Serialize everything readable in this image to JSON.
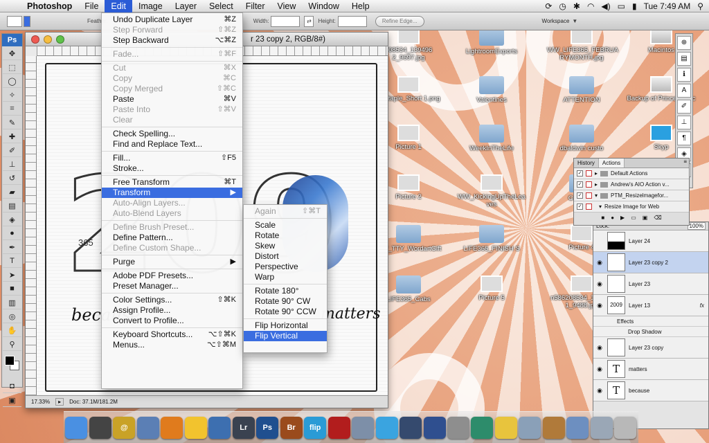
{
  "menubar": {
    "app_name": "Photoshop",
    "items": [
      "File",
      "Edit",
      "Image",
      "Layer",
      "Select",
      "Filter",
      "View",
      "Window",
      "Help"
    ],
    "clock": "Tue 7:49 AM"
  },
  "optionsbar": {
    "feather_label": "Feather:",
    "width_label": "Width:",
    "height_label": "Height:",
    "refine_edge": "Refine Edge...",
    "workspace": "Workspace"
  },
  "tools": {
    "badge": "Ps"
  },
  "document": {
    "title": "r 23 copy 2, RGB/8#)",
    "zoom": "17.33%",
    "doc_size": "Doc: 37.1M/181.2M",
    "canvas_number": "209",
    "canvas_text": "because",
    "canvas_text2": "matters",
    "photo_number": "365"
  },
  "edit_menu": {
    "items": [
      {
        "label": "Undo Duplicate Layer",
        "shortcut": "⌘Z",
        "disabled": false
      },
      {
        "label": "Step Forward",
        "shortcut": "⇧⌘Z",
        "disabled": true
      },
      {
        "label": "Step Backward",
        "shortcut": "⌥⌘Z",
        "disabled": false
      },
      {
        "sep": true
      },
      {
        "label": "Fade...",
        "shortcut": "⇧⌘F",
        "disabled": true
      },
      {
        "sep": true
      },
      {
        "label": "Cut",
        "shortcut": "⌘X",
        "disabled": true
      },
      {
        "label": "Copy",
        "shortcut": "⌘C",
        "disabled": true
      },
      {
        "label": "Copy Merged",
        "shortcut": "⇧⌘C",
        "disabled": true
      },
      {
        "label": "Paste",
        "shortcut": "⌘V",
        "disabled": false
      },
      {
        "label": "Paste Into",
        "shortcut": "⇧⌘V",
        "disabled": true
      },
      {
        "label": "Clear",
        "shortcut": "",
        "disabled": true
      },
      {
        "sep": true
      },
      {
        "label": "Check Spelling...",
        "shortcut": "",
        "disabled": false
      },
      {
        "label": "Find and Replace Text...",
        "shortcut": "",
        "disabled": false
      },
      {
        "sep": true
      },
      {
        "label": "Fill...",
        "shortcut": "⇧F5",
        "disabled": false
      },
      {
        "label": "Stroke...",
        "shortcut": "",
        "disabled": false
      },
      {
        "sep": true
      },
      {
        "label": "Free Transform",
        "shortcut": "⌘T",
        "disabled": false
      },
      {
        "label": "Transform",
        "shortcut": "▶",
        "disabled": false,
        "highlight": true
      },
      {
        "label": "Auto-Align Layers...",
        "shortcut": "",
        "disabled": true
      },
      {
        "label": "Auto-Blend Layers",
        "shortcut": "",
        "disabled": true
      },
      {
        "sep": true
      },
      {
        "label": "Define Brush Preset...",
        "shortcut": "",
        "disabled": true
      },
      {
        "label": "Define Pattern...",
        "shortcut": "",
        "disabled": false
      },
      {
        "label": "Define Custom Shape...",
        "shortcut": "",
        "disabled": true
      },
      {
        "sep": true
      },
      {
        "label": "Purge",
        "shortcut": "▶",
        "disabled": false
      },
      {
        "sep": true
      },
      {
        "label": "Adobe PDF Presets...",
        "shortcut": "",
        "disabled": false
      },
      {
        "label": "Preset Manager...",
        "shortcut": "",
        "disabled": false
      },
      {
        "sep": true
      },
      {
        "label": "Color Settings...",
        "shortcut": "⇧⌘K",
        "disabled": false
      },
      {
        "label": "Assign Profile...",
        "shortcut": "",
        "disabled": false
      },
      {
        "label": "Convert to Profile...",
        "shortcut": "",
        "disabled": false
      },
      {
        "sep": true
      },
      {
        "label": "Keyboard Shortcuts...",
        "shortcut": "⌥⇧⌘K",
        "disabled": false
      },
      {
        "label": "Menus...",
        "shortcut": "⌥⇧⌘M",
        "disabled": false
      }
    ]
  },
  "transform_menu": {
    "items": [
      {
        "label": "Again",
        "shortcut": "⇧⌘T",
        "disabled": true
      },
      {
        "sep": true
      },
      {
        "label": "Scale",
        "disabled": false
      },
      {
        "label": "Rotate",
        "disabled": false
      },
      {
        "label": "Skew",
        "disabled": false
      },
      {
        "label": "Distort",
        "disabled": false
      },
      {
        "label": "Perspective",
        "disabled": false
      },
      {
        "label": "Warp",
        "disabled": false
      },
      {
        "sep": true
      },
      {
        "label": "Rotate 180°",
        "disabled": false
      },
      {
        "label": "Rotate 90° CW",
        "disabled": false
      },
      {
        "label": "Rotate 90° CCW",
        "disabled": false
      },
      {
        "sep": true
      },
      {
        "label": "Flip Horizontal",
        "disabled": false
      },
      {
        "label": "Flip Vertical",
        "disabled": false,
        "highlight": true
      }
    ]
  },
  "desktop_icons": [
    {
      "label": "208534_139496 2_9697.jpg",
      "kind": "thumb"
    },
    {
      "label": "LightroomExports",
      "kind": "folder"
    },
    {
      "label": "WW_LIFE365_FEBRUA RYMONTH.jpg",
      "kind": "thumb"
    },
    {
      "label": "Macintos",
      "kind": "drive"
    },
    {
      "label": "y_Staple_Short 1.png",
      "kind": "thumb"
    },
    {
      "label": "Valentines",
      "kind": "folder"
    },
    {
      "label": "ATTENTION",
      "kind": "folder"
    },
    {
      "label": "Backup of Prince's Mac",
      "kind": "drive"
    },
    {
      "label": "Picture 1",
      "kind": "thumb"
    },
    {
      "label": "WeekInTheLife",
      "kind": "folder"
    },
    {
      "label": "dbaldwin custo",
      "kind": "folder"
    },
    {
      "label": "Skyp",
      "kind": "app"
    },
    {
      "label": "Picture 2",
      "kind": "thumb"
    },
    {
      "label": "WW_KickingUpTheLea ves",
      "kind": "thumb"
    },
    {
      "label": "Coordina",
      "kind": "folder"
    },
    {
      "label": "Picture 3",
      "kind": "thumb"
    },
    {
      "label": "WW_TTY_WordartGift",
      "kind": "folder"
    },
    {
      "label": "LIFE365_FINISH S",
      "kind": "folder"
    },
    {
      "label": "Picture 4",
      "kind": "thumb"
    },
    {
      "label": "n586208534_139496 0_9272.jpg",
      "kind": "thumb"
    },
    {
      "label": "LIFE365_Cabs",
      "kind": "folder"
    },
    {
      "label": "Picture 5",
      "kind": "thumb"
    },
    {
      "label": "n586208534_139496 1_9488.jpg",
      "kind": "thumb"
    },
    {
      "label": "LIFE365200",
      "kind": "folder"
    }
  ],
  "actions_panel": {
    "tabs": [
      "History",
      "Actions"
    ],
    "rows": [
      "Default Actions",
      "Andrew's AIO Action v...",
      "PTM_Resizelmagefor...",
      "Resize Image for Web"
    ]
  },
  "layers_panel": {
    "opacity": "100%",
    "lock_label": "Lock:",
    "layers": [
      {
        "name": "Layer 24",
        "thumb": "",
        "selected": false
      },
      {
        "name": "Layer 23 copy 2",
        "thumb": "",
        "selected": true
      },
      {
        "name": "Layer 23",
        "thumb": "",
        "selected": false
      },
      {
        "name": "Layer 13",
        "thumb": "2009",
        "selected": false,
        "fx": "fx"
      },
      {
        "name": "Layer 23 copy",
        "thumb": "",
        "selected": false
      },
      {
        "name": "matters",
        "thumb": "T",
        "selected": false
      },
      {
        "name": "because",
        "thumb": "T",
        "selected": false
      }
    ],
    "effects_label": "Effects",
    "drop_shadow": "Drop Shadow"
  },
  "dock": {
    "apps": [
      {
        "name": "finder",
        "label": "",
        "color": "#4a90e2"
      },
      {
        "name": "dashboard",
        "label": "",
        "color": "#444444"
      },
      {
        "name": "address-book",
        "label": "@",
        "color": "#c9a227"
      },
      {
        "name": "preview",
        "label": "",
        "color": "#5b7fb5"
      },
      {
        "name": "firefox",
        "label": "",
        "color": "#e07b1d"
      },
      {
        "name": "adium",
        "label": "",
        "color": "#f2c32e"
      },
      {
        "name": "iphoto",
        "label": "",
        "color": "#3d6fb0"
      },
      {
        "name": "lightroom",
        "label": "Lr",
        "color": "#3a4250"
      },
      {
        "name": "photoshop",
        "label": "Ps",
        "color": "#1f4f8f"
      },
      {
        "name": "bridge",
        "label": "Br",
        "color": "#9a4b1c"
      },
      {
        "name": "flip",
        "label": "flip",
        "color": "#2a9bd6"
      },
      {
        "name": "photo-booth",
        "label": "",
        "color": "#b21d1d"
      },
      {
        "name": "preview2",
        "label": "",
        "color": "#7d8fa8"
      },
      {
        "name": "itunes",
        "label": "",
        "color": "#3aa4e0"
      },
      {
        "name": "imovie",
        "label": "",
        "color": "#354a6e"
      },
      {
        "name": "spaces",
        "label": "",
        "color": "#2f4f8f"
      },
      {
        "name": "system-prefs",
        "label": "",
        "color": "#8e8e8e"
      },
      {
        "name": "time-machine",
        "label": "",
        "color": "#2d8c6b"
      },
      {
        "name": "cyberduck",
        "label": "",
        "color": "#e8c43d"
      },
      {
        "name": "disk-utility",
        "label": "",
        "color": "#8aa0b8"
      },
      {
        "name": "keynote",
        "label": "",
        "color": "#b07a3a"
      },
      {
        "name": "image-capture",
        "label": "",
        "color": "#6d8fc0"
      },
      {
        "name": "downloads",
        "label": "",
        "color": "#9aa7b6"
      },
      {
        "name": "trash",
        "label": "",
        "color": "#b8b8b8"
      }
    ]
  }
}
